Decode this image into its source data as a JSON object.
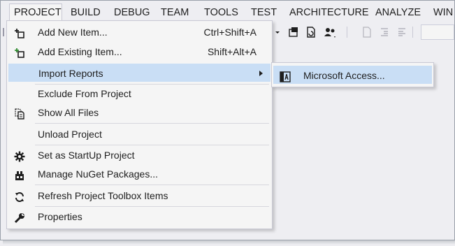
{
  "menubar": {
    "items": [
      {
        "label": "PROJECT"
      },
      {
        "label": "BUILD"
      },
      {
        "label": "DEBUG"
      },
      {
        "label": "TEAM"
      },
      {
        "label": "TOOLS"
      },
      {
        "label": "TEST"
      },
      {
        "label": "ARCHITECTURE"
      },
      {
        "label": "ANALYZE"
      },
      {
        "label": "WIN"
      }
    ]
  },
  "project_menu": {
    "items": [
      {
        "label": "Add New Item...",
        "shortcut": "Ctrl+Shift+A",
        "icon": "add-new-item-icon"
      },
      {
        "label": "Add Existing Item...",
        "shortcut": "Shift+Alt+A",
        "icon": "add-existing-item-icon"
      },
      {
        "label": "Import Reports",
        "icon": "none",
        "has_submenu": true,
        "highlighted": true
      },
      {
        "label": "Exclude From Project",
        "icon": "none"
      },
      {
        "label": "Show All Files",
        "icon": "show-all-files-icon"
      },
      {
        "label": "Unload Project",
        "icon": "none"
      },
      {
        "label": "Set as StartUp Project",
        "icon": "gear-icon"
      },
      {
        "label": "Manage NuGet Packages...",
        "icon": "nuget-package-icon"
      },
      {
        "label": "Refresh Project Toolbox Items",
        "icon": "refresh-icon"
      },
      {
        "label": "Properties",
        "icon": "wrench-icon"
      }
    ]
  },
  "import_reports_submenu": {
    "items": [
      {
        "label": "Microsoft Access...",
        "icon": "microsoft-access-icon",
        "highlighted": true
      }
    ]
  },
  "colors": {
    "background": "#eeeef2",
    "menu_background": "#f5f5f5",
    "highlight": "#c9def5",
    "border": "#c9c9d4",
    "text": "#1e1e1e"
  }
}
